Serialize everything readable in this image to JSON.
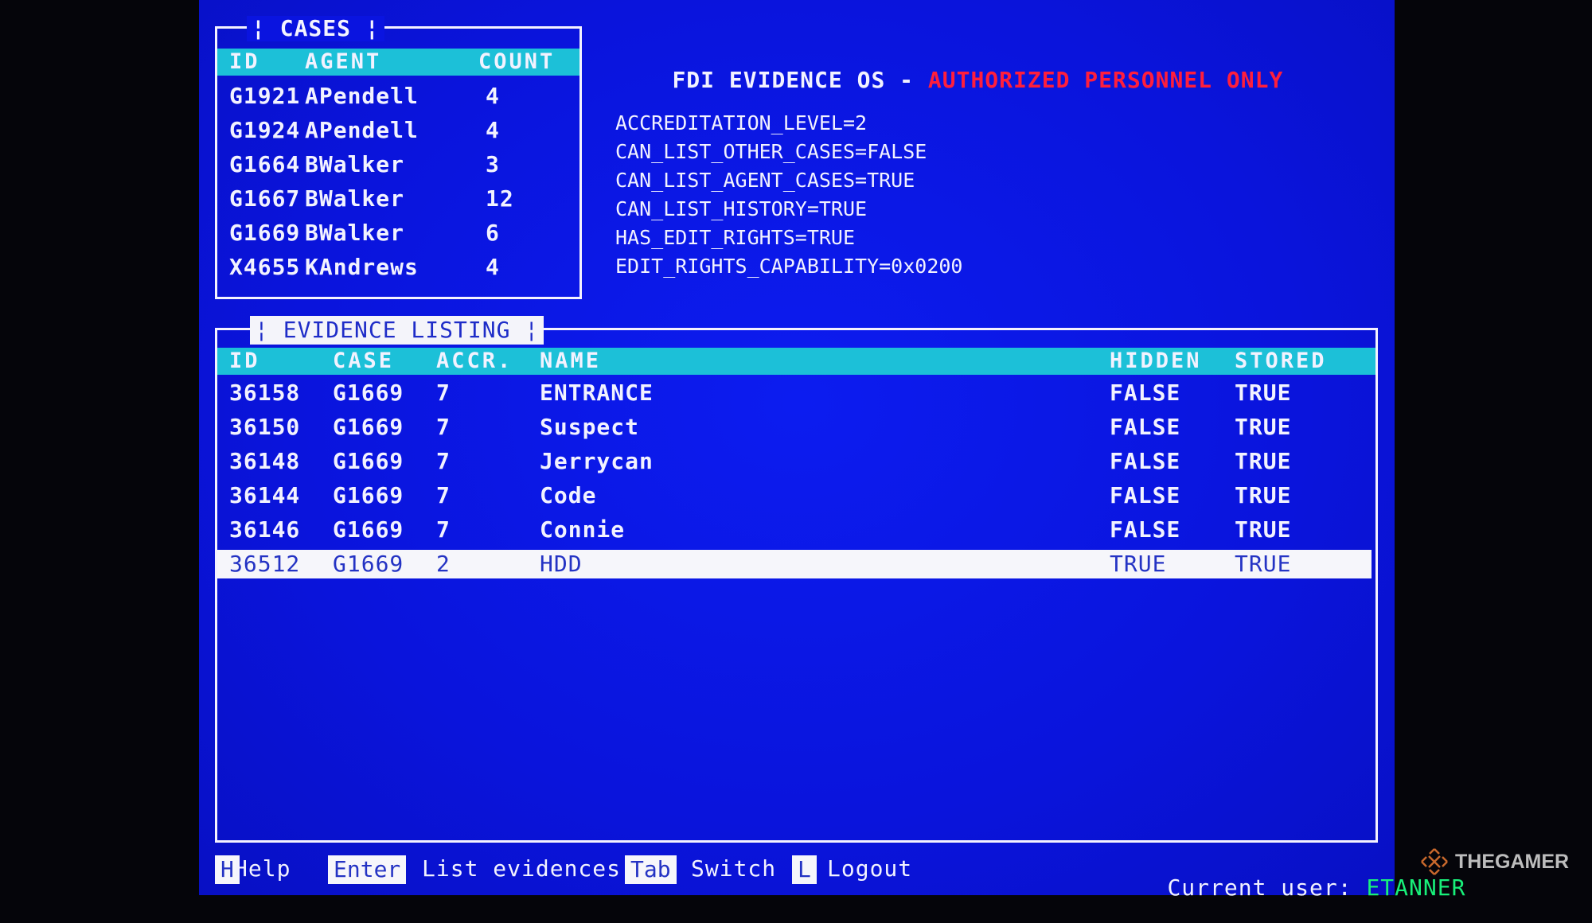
{
  "cases_panel": {
    "title": "¦ CASES ¦",
    "columns": [
      "ID",
      "AGENT",
      "COUNT"
    ],
    "rows": [
      {
        "id": "G1921",
        "agent": "APendell",
        "count": "4"
      },
      {
        "id": "G1924",
        "agent": "APendell",
        "count": "4"
      },
      {
        "id": "G1664",
        "agent": "BWalker",
        "count": "3"
      },
      {
        "id": "G1667",
        "agent": "BWalker",
        "count": "12"
      },
      {
        "id": "G1669",
        "agent": "BWalker",
        "count": "6"
      },
      {
        "id": "X4655",
        "agent": "KAndrews",
        "count": "4"
      }
    ]
  },
  "header": {
    "title": "FDI EVIDENCE OS - ",
    "warning": "AUTHORIZED PERSONNEL ONLY",
    "warning_color": "#ff1e3c"
  },
  "config": [
    "ACCREDITATION_LEVEL=2",
    "CAN_LIST_OTHER_CASES=FALSE",
    "CAN_LIST_AGENT_CASES=TRUE",
    "CAN_LIST_HISTORY=TRUE",
    "HAS_EDIT_RIGHTS=TRUE",
    "EDIT_RIGHTS_CAPABILITY=0x0200"
  ],
  "evidence_panel": {
    "title": "¦ EVIDENCE LISTING ¦",
    "columns": [
      "ID",
      "CASE",
      "ACCR.",
      "NAME",
      "HIDDEN",
      "STORED"
    ],
    "rows": [
      {
        "id": "36158",
        "case": "G1669",
        "accr": "7",
        "name": "ENTRANCE",
        "hidden": "FALSE",
        "stored": "TRUE",
        "selected": false
      },
      {
        "id": "36150",
        "case": "G1669",
        "accr": "7",
        "name": "Suspect",
        "hidden": "FALSE",
        "stored": "TRUE",
        "selected": false
      },
      {
        "id": "36148",
        "case": "G1669",
        "accr": "7",
        "name": "Jerrycan",
        "hidden": "FALSE",
        "stored": "TRUE",
        "selected": false
      },
      {
        "id": "36144",
        "case": "G1669",
        "accr": "7",
        "name": "Code",
        "hidden": "FALSE",
        "stored": "TRUE",
        "selected": false
      },
      {
        "id": "36146",
        "case": "G1669",
        "accr": "7",
        "name": "Connie",
        "hidden": "FALSE",
        "stored": "TRUE",
        "selected": false
      },
      {
        "id": "36512",
        "case": "G1669",
        "accr": "2",
        "name": "HDD",
        "hidden": "TRUE",
        "stored": "TRUE",
        "selected": true
      }
    ]
  },
  "footer": {
    "shortcuts": [
      {
        "key": "H",
        "label": "Help"
      },
      {
        "key": "Enter",
        "label": "List evidences"
      },
      {
        "key": "Tab",
        "label": "Switch"
      },
      {
        "key": "L",
        "label": "Logout"
      }
    ],
    "current_user_label": "Current user:",
    "current_user": "ETANNER",
    "current_user_color": "#18f07a"
  },
  "watermark": {
    "text": "THEGAMER",
    "icon": "thegamer-logo-icon"
  },
  "colors": {
    "screen_bg": "#0a14e0",
    "header_row_bg": "#1cc0d8",
    "selected_row_bg": "#f6f6fb",
    "selected_text": "#2433c4",
    "text": "#f2f2ff"
  }
}
